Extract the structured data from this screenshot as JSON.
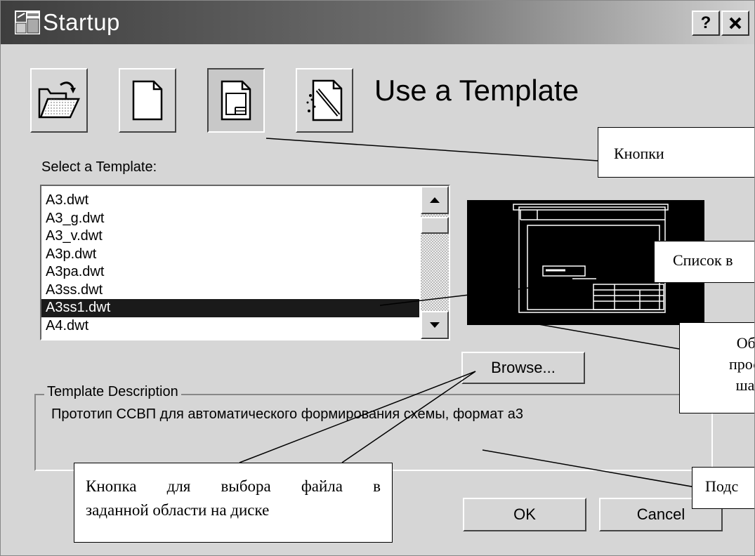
{
  "window": {
    "title": "Startup",
    "help_button": "?",
    "close_button": "✕"
  },
  "toolbar": {
    "buttons": [
      {
        "icon": "open-folder-icon"
      },
      {
        "icon": "blank-document-icon"
      },
      {
        "icon": "template-document-icon",
        "pressed": true
      },
      {
        "icon": "wizard-icon"
      }
    ],
    "heading": "Use a Template"
  },
  "template_list": {
    "label": "Select a Template:",
    "items": [
      "A3.dwt",
      "A3_g.dwt",
      "A3_v.dwt",
      "A3p.dwt",
      "A3pa.dwt",
      "A3ss.dwt",
      "A3ss1.dwt",
      "A4.dwt"
    ],
    "selected": "A3ss1.dwt"
  },
  "browse_button": "Browse...",
  "template_description": {
    "legend": "Template Description",
    "text": "Прототип ССВП для автоматического формирования схемы, формат а3"
  },
  "footer": {
    "ok_label": "OK",
    "cancel_label": "Cancel"
  },
  "callouts": {
    "buttons": "Кнопки",
    "list": "Список в",
    "preview": [
      "Обла",
      "просм",
      "шабл"
    ],
    "description": "Подс",
    "browse": [
      "Кнопка для выбора файла в",
      "заданной области на диске"
    ]
  },
  "colors": {
    "dialog_bg": "#d6d6d6",
    "title_gradient_start": "#3e3e3e",
    "selection": "#1a1a1a",
    "preview_bg": "#000000"
  }
}
